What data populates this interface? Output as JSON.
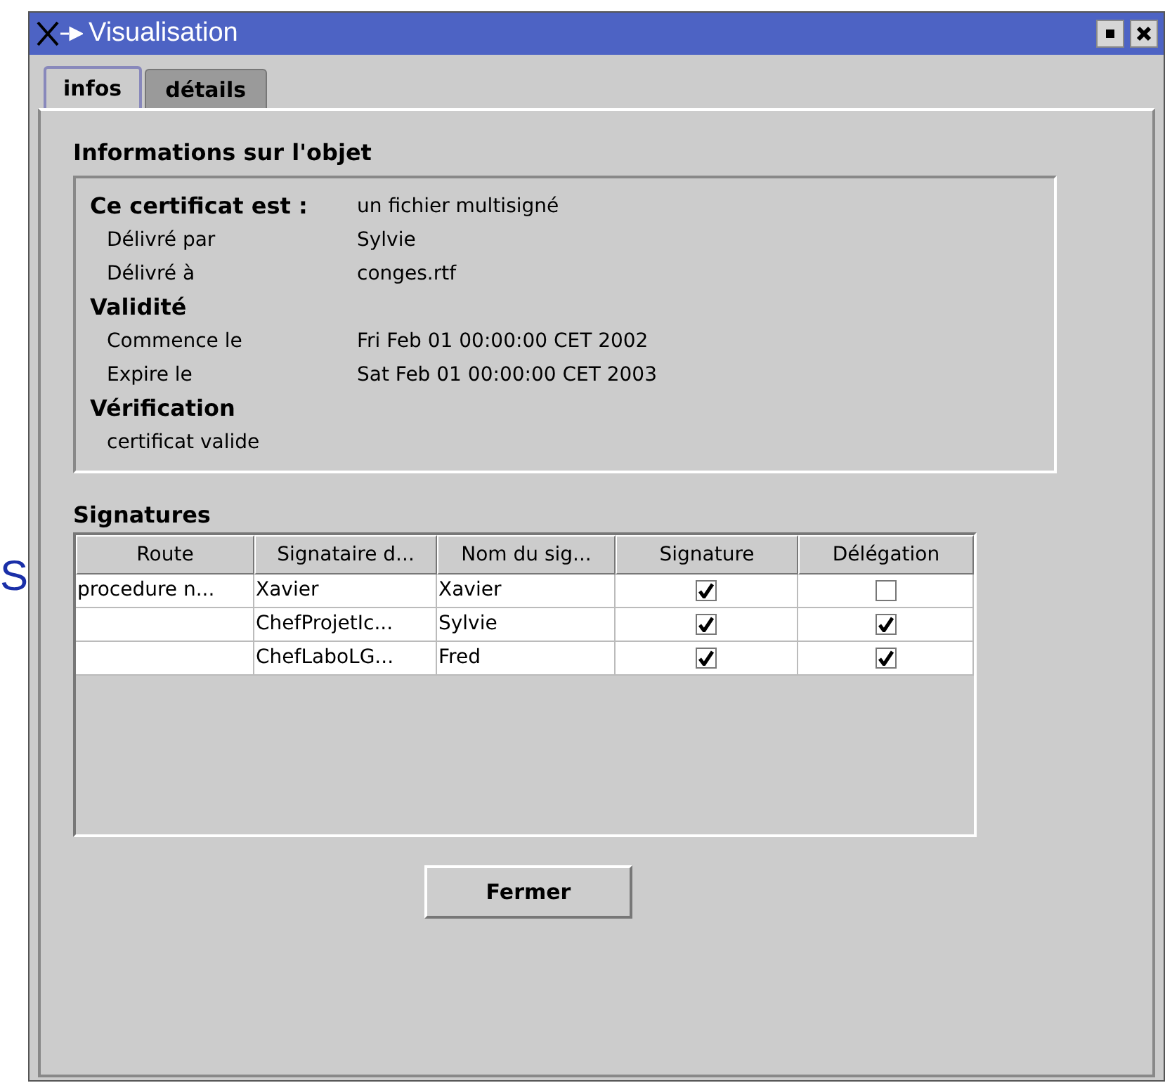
{
  "background_text": "S",
  "window": {
    "title": "Visualisation"
  },
  "tabs": [
    {
      "label": "infos",
      "selected": true
    },
    {
      "label": "détails",
      "selected": false
    }
  ],
  "object_info": {
    "heading": "Informations sur l'objet",
    "rows": [
      {
        "kind": "main",
        "label": "Ce certificat est :",
        "value": "un fichier multisigné"
      },
      {
        "kind": "field",
        "label": "Délivré par",
        "value": "Sylvie"
      },
      {
        "kind": "field",
        "label": "Délivré à",
        "value": "conges.rtf"
      },
      {
        "kind": "section",
        "label": "Validité"
      },
      {
        "kind": "field",
        "label": "Commence le",
        "value": "Fri Feb 01 00:00:00 CET 2002"
      },
      {
        "kind": "field",
        "label": "Expire le",
        "value": "Sat Feb 01 00:00:00 CET 2003"
      },
      {
        "kind": "section",
        "label": "Vérification"
      },
      {
        "kind": "field",
        "label": "certificat valide"
      }
    ]
  },
  "signatures": {
    "heading": "Signatures",
    "columns": [
      "Route",
      "Signataire d...",
      "Nom du sig...",
      "Signature",
      "Délégation"
    ],
    "rows": [
      {
        "route": "procedure n...",
        "signataire": "Xavier",
        "nom": "Xavier",
        "signature": true,
        "delegation": false
      },
      {
        "signataire": "ChefProjetIc...",
        "nom": "Sylvie",
        "signature": true,
        "delegation": true
      },
      {
        "signataire": "ChefLaboLG...",
        "nom": "Fred",
        "signature": true,
        "delegation": true
      }
    ]
  },
  "buttons": [
    "Fermer"
  ]
}
